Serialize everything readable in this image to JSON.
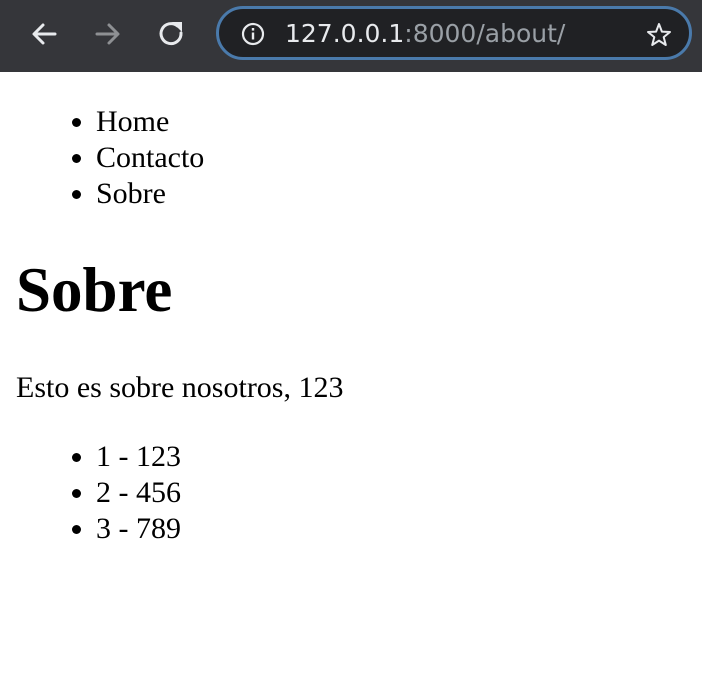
{
  "browser": {
    "url_host": "127.0.0.1",
    "url_rest": ":8000/about/",
    "icons": {
      "back": "arrow-left-icon",
      "forward": "arrow-right-icon",
      "reload": "reload-icon",
      "info": "info-icon",
      "bookmark": "star-icon"
    },
    "colors": {
      "toolbar_bg": "#35363a",
      "omnibox_bg": "#202124",
      "omnibox_border": "#4a7aab",
      "url_host": "#e8eaed",
      "url_rest": "#9aa0a6"
    }
  },
  "page": {
    "nav": [
      {
        "label": "Home"
      },
      {
        "label": "Contacto"
      },
      {
        "label": "Sobre"
      }
    ],
    "title": "Sobre",
    "description": "Esto es sobre nosotros, 123",
    "items": [
      {
        "text": "1 - 123"
      },
      {
        "text": "2 - 456"
      },
      {
        "text": "3 - 789"
      }
    ]
  }
}
